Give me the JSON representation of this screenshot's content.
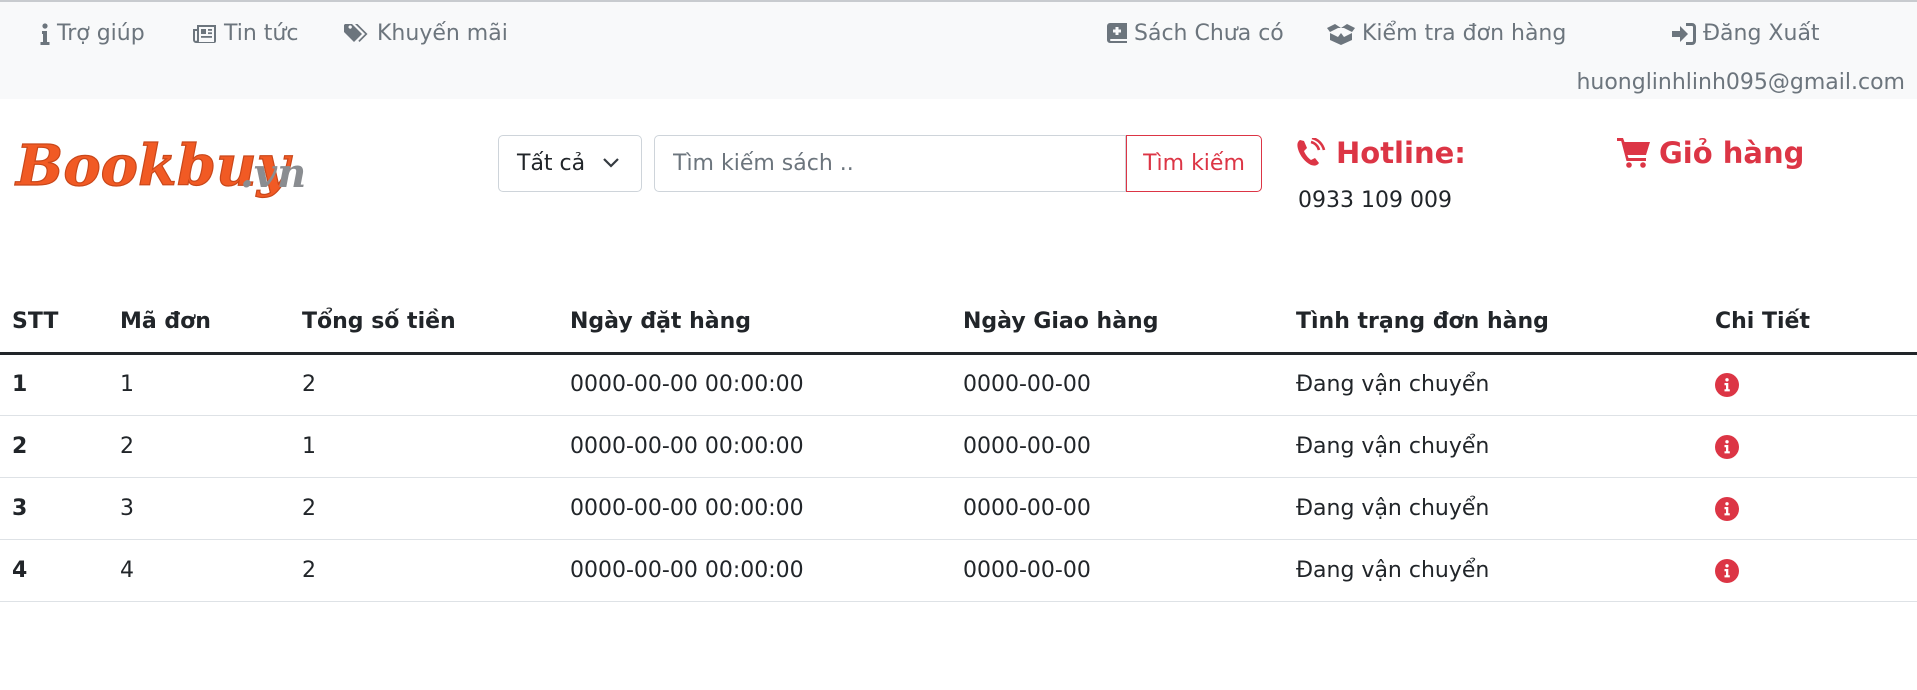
{
  "topnav": {
    "help": "Trợ giúp",
    "news": "Tin tức",
    "promo": "Khuyến mãi",
    "missing_books": "Sách Chưa có",
    "check_order": "Kiểm tra đơn hàng",
    "logout": "Đăng Xuất",
    "user_email": "huonglinhlinh095@gmail.com"
  },
  "header": {
    "logo_text": "Bookbuy.vn",
    "category_select": "Tất cả",
    "search_placeholder": "Tìm kiếm sách ..",
    "search_button": "Tìm kiếm",
    "hotline_label": "Hotline:",
    "hotline_number": "0933 109 009",
    "cart_label": "Giỏ hàng"
  },
  "colors": {
    "accent_red": "#dc3545",
    "logo_orange": "#f15a24",
    "logo_gray": "#8a8d91",
    "muted_text": "#6c757d",
    "topbar_bg": "#f8f9fa"
  },
  "orders": {
    "headers": [
      "STT",
      "Mã đơn",
      "Tổng số tiền",
      "Ngày đặt hàng",
      "Ngày Giao hàng",
      "Tình trạng đơn hàng",
      "Chi Tiết"
    ],
    "rows": [
      {
        "stt": "1",
        "ma_don": "1",
        "tong_tien": "2",
        "ngay_dat": "0000-00-00 00:00:00",
        "ngay_giao": "0000-00-00",
        "tinh_trang": "Đang vận chuyển",
        "detail_icon": "info-circle-icon"
      },
      {
        "stt": "2",
        "ma_don": "2",
        "tong_tien": "1",
        "ngay_dat": "0000-00-00 00:00:00",
        "ngay_giao": "0000-00-00",
        "tinh_trang": "Đang vận chuyển",
        "detail_icon": "info-circle-icon"
      },
      {
        "stt": "3",
        "ma_don": "3",
        "tong_tien": "2",
        "ngay_dat": "0000-00-00 00:00:00",
        "ngay_giao": "0000-00-00",
        "tinh_trang": "Đang vận chuyển",
        "detail_icon": "info-circle-icon"
      },
      {
        "stt": "4",
        "ma_don": "4",
        "tong_tien": "2",
        "ngay_dat": "0000-00-00 00:00:00",
        "ngay_giao": "0000-00-00",
        "tinh_trang": "Đang vận chuyển",
        "detail_icon": "info-circle-icon"
      }
    ]
  }
}
